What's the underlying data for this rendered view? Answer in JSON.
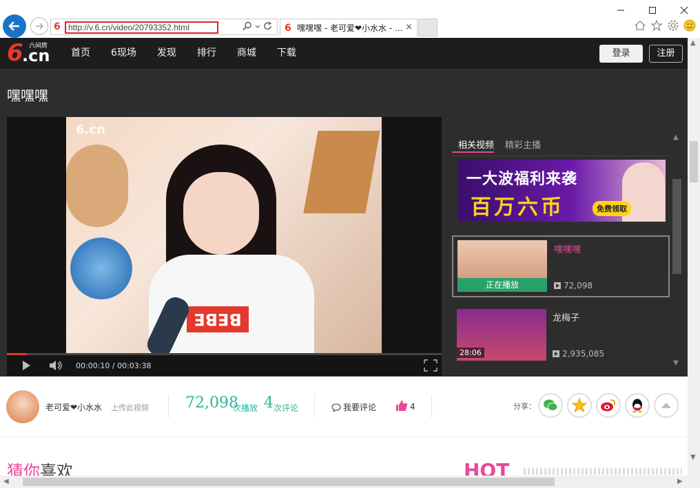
{
  "browser": {
    "url": "http://v.6.cn/video/20793352.html",
    "tab_title": "嘿嘿嘿 - 老可爱❤小水水 - ...",
    "tab_close": "×"
  },
  "site": {
    "logo_text": "6.cn",
    "logo_sub": "六间房",
    "nav": [
      "首页",
      "6现场",
      "发现",
      "排行",
      "商城",
      "下载"
    ],
    "login": "登录",
    "register": "注册"
  },
  "video": {
    "title": "嘿嘿嘿",
    "watermark": "6.cn",
    "shirt_text": "BEBE",
    "current_time": "00:00:10",
    "total_time": "00:03:38",
    "time_display": "00:00:10 / 00:03:38",
    "progress": 0.046
  },
  "sidebar": {
    "tabs": [
      "相关视频",
      "精彩主播"
    ],
    "active_tab": 0,
    "banner": {
      "line1": "一大波福利来袭",
      "line2": "百万六币",
      "cta": "免费领取"
    },
    "cards": [
      {
        "title": "嘿嘿嘿",
        "views": "72,098",
        "status": "正在播放"
      },
      {
        "title": "龙梅子",
        "views": "2,935,085",
        "duration": "28:06"
      }
    ]
  },
  "info": {
    "uploader": "老可爱❤小水水",
    "upload_label": "上传此视频",
    "play_count": "72,098",
    "play_label": "次播放",
    "comment_count": "4",
    "comment_label": "次评论",
    "comment_btn": "我要评论",
    "likes": "4",
    "share_label": "分享："
  },
  "bottom": {
    "guess_part1": "猜你",
    "guess_part2": "喜欢",
    "hot": "HOT"
  },
  "colors": {
    "accent_red": "#e8372c",
    "pink": "#e8489a",
    "teal": "#2cb59a",
    "browser_blue": "#1a73c9"
  }
}
